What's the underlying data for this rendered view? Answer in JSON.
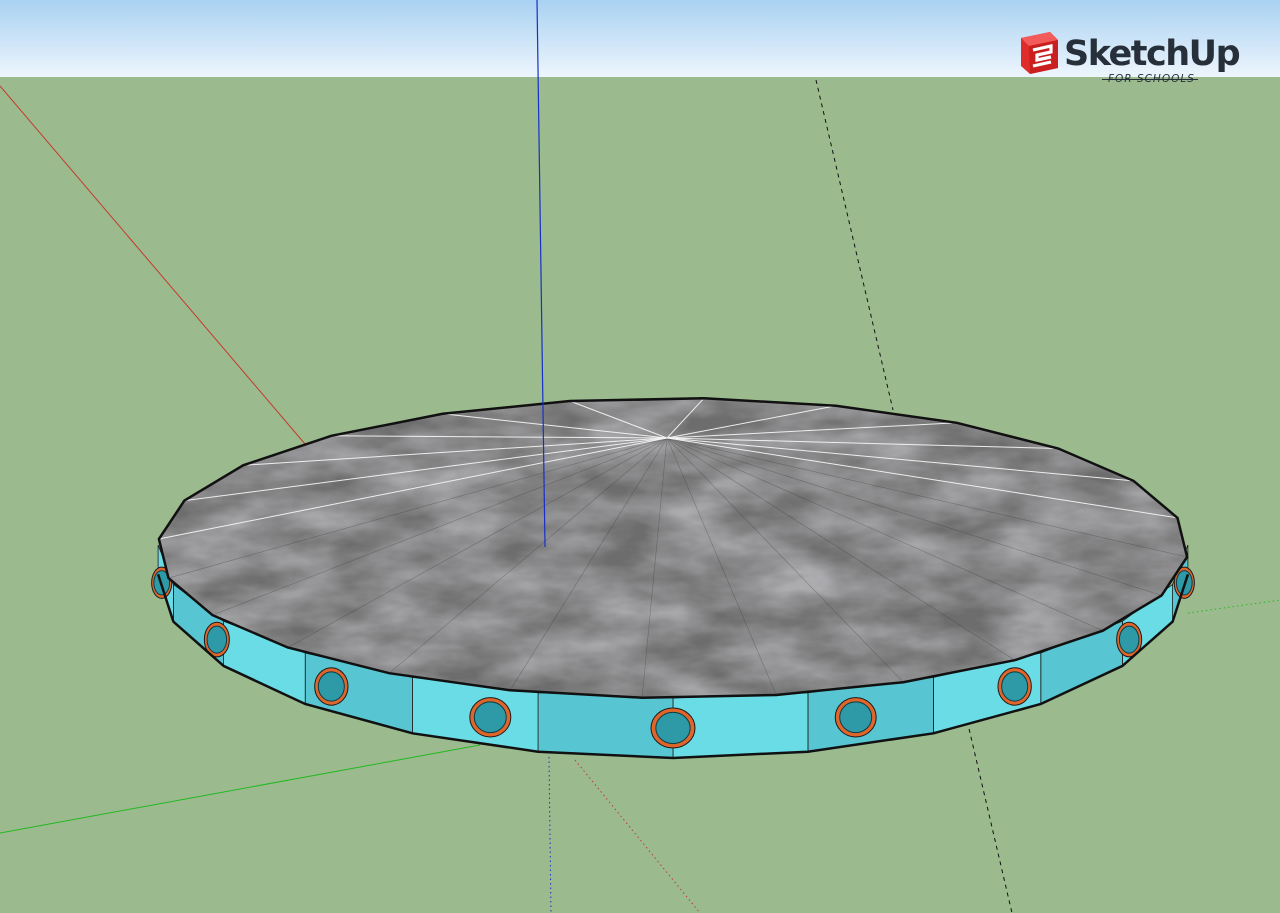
{
  "app": {
    "name": "SketchUp",
    "edition": "FOR SCHOOLS"
  },
  "colors": {
    "sky_top": "#a9d1f2",
    "sky_bottom": "#eef6fd",
    "ground": "#9bbb8f",
    "axis_red": "#c43a2e",
    "axis_green": "#23b81f",
    "axis_blue": "#1730c8",
    "band": "#6adce6",
    "band_shade": "#58c6d2",
    "porthole_glass": "#2e9aa8",
    "porthole_ring": "#e0652b",
    "top_surface": "#6d6d6d",
    "logo_red": "#e02b2b"
  },
  "icons": {
    "logo": "sketchup-logo-icon"
  },
  "model": {
    "shape": "saucer",
    "top_segments": 24,
    "side_segments": 24,
    "portholes_visible": 9
  }
}
